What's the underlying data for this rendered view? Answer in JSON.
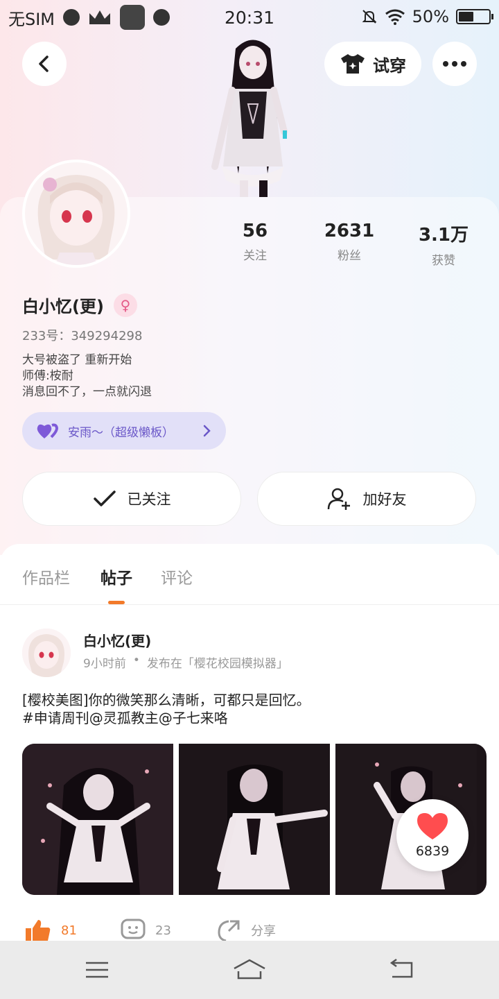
{
  "status_bar": {
    "carrier": "无SIM",
    "time": "20:31",
    "battery": "50%",
    "battery_level": 0.5
  },
  "nav": {
    "tryon_label": "试穿"
  },
  "profile": {
    "stats": [
      {
        "value": "56",
        "label": "关注"
      },
      {
        "value": "2631",
        "label": "粉丝"
      },
      {
        "value": "3.1万",
        "label": "获赞"
      }
    ],
    "name": "白小忆(更)",
    "id_line": "233号：349294298",
    "bio": [
      "大号被盗了  重新开始",
      "师傅:桉耐",
      "消息回不了，一点就闪退"
    ],
    "master_chip": "安雨～（超级懒板）",
    "follow_label": "已关注",
    "add_friend_label": "加好友"
  },
  "tabs": [
    "作品栏",
    "帖子",
    "评论"
  ],
  "active_tab": 1,
  "post": {
    "author": "白小忆(更)",
    "time": "9小时前",
    "source": "发布在「樱花校园模拟器」",
    "text_line1": "[樱校美图]你的微笑那么清晰，可都只是回忆。",
    "text_line2": "#申请周刊@灵孤教主@子七来咯",
    "like_float_count": "6839",
    "likes": "81",
    "comments": "23",
    "share_label": "分享"
  },
  "colors": {
    "accent": "#f27a2a",
    "chip_text": "#6a57c8",
    "chip_bg": "#e2e0f8",
    "heart": "#ff4d4f"
  }
}
